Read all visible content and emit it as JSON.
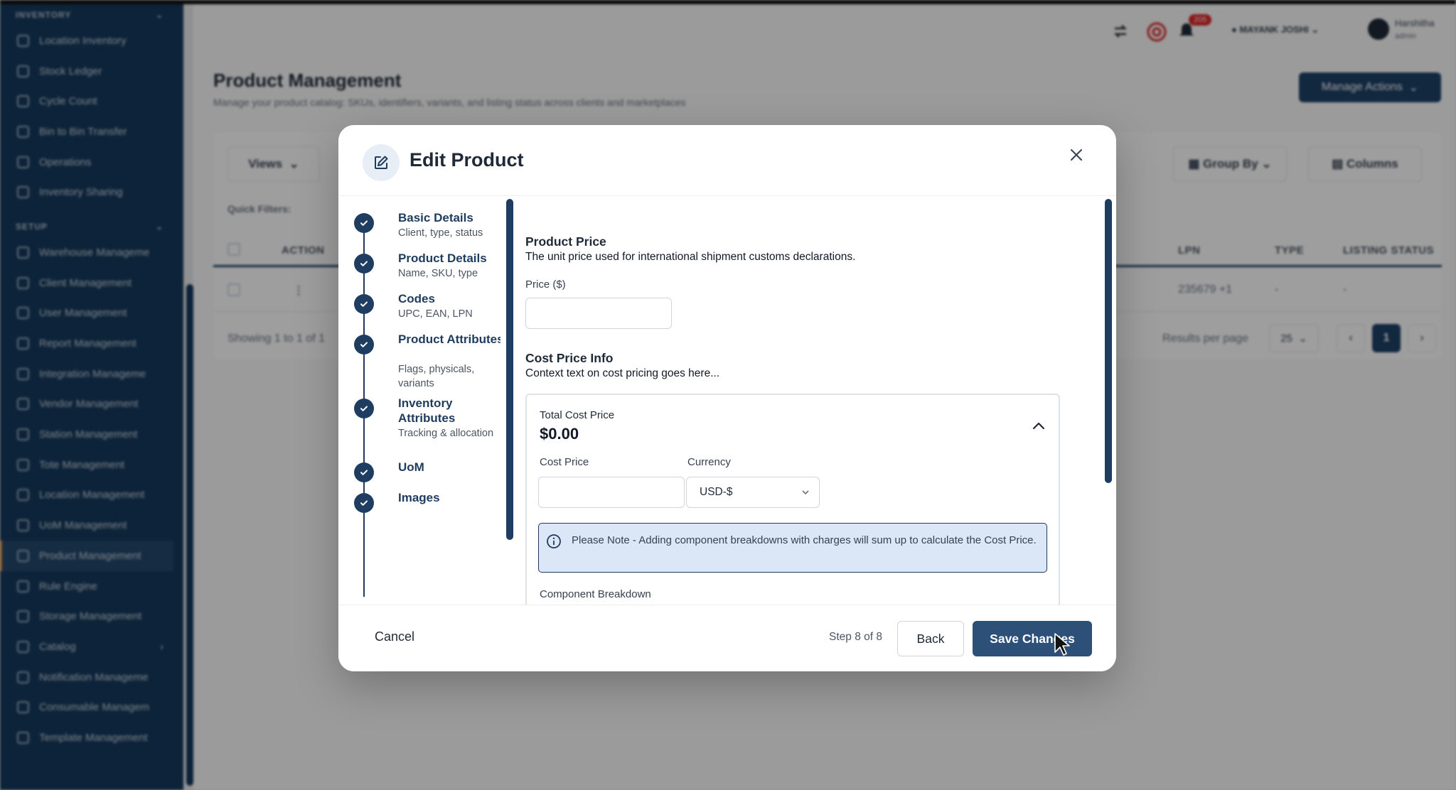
{
  "sidebar": {
    "sections": {
      "inventory": "INVENTORY",
      "setup": "SETUP"
    },
    "inventory_items": [
      {
        "label": "Location Inventory"
      },
      {
        "label": "Stock Ledger"
      },
      {
        "label": "Cycle Count"
      },
      {
        "label": "Bin to Bin Transfer"
      },
      {
        "label": "Operations"
      },
      {
        "label": "Inventory Sharing"
      }
    ],
    "setup_items": [
      {
        "label": "Warehouse Manageme"
      },
      {
        "label": "Client Management"
      },
      {
        "label": "User Management"
      },
      {
        "label": "Report Management"
      },
      {
        "label": "Integration Manageme"
      },
      {
        "label": "Vendor Management"
      },
      {
        "label": "Station Management"
      },
      {
        "label": "Tote Management"
      },
      {
        "label": "Location Management"
      },
      {
        "label": "UoM Management"
      },
      {
        "label": "Product Management"
      },
      {
        "label": "Rule Engine"
      },
      {
        "label": "Storage Management"
      },
      {
        "label": "Catalog"
      },
      {
        "label": "Notification Manageme"
      },
      {
        "label": "Consumable Managem"
      },
      {
        "label": "Template Management"
      }
    ],
    "active_item": "Product Management"
  },
  "topbar": {
    "notification_count": "205",
    "warehouse": "MAYANK JOSHI",
    "user_name": "Harshitha",
    "user_role": "admin"
  },
  "page": {
    "title": "Product Management",
    "subtitle": "Manage your product catalog: SKUs, identifiers, variants, and listing status across clients and marketplaces",
    "manage_actions": "Manage Actions",
    "views": "Views",
    "group_by": "Group By",
    "columns": "Columns",
    "quick_filters": "Quick Filters:",
    "table_headers": {
      "action": "ACTION",
      "lpn": "LPN",
      "type": "TYPE",
      "listing_status": "LISTING STATUS"
    },
    "row": {
      "lpn": "235679 +1",
      "type": "-",
      "listing_status": "-"
    },
    "showing": "Showing 1 to 1 of 1",
    "results_per_page": "Results per page",
    "per_page_value": "25",
    "current_page": "1"
  },
  "modal": {
    "title": "Edit Product",
    "steps": [
      {
        "title": "Basic Details",
        "subtitle": "Client, type, status"
      },
      {
        "title": "Product Details",
        "subtitle": "Name, SKU, type"
      },
      {
        "title": "Codes",
        "subtitle": "UPC, EAN, LPN"
      },
      {
        "title": "Product Attributes",
        "subtitle": "Flags, physicals, variants"
      },
      {
        "title": "Inventory Attributes",
        "subtitle": "Tracking & allocation"
      },
      {
        "title": "UoM",
        "subtitle": ""
      },
      {
        "title": "Images",
        "subtitle": ""
      }
    ],
    "product_price": {
      "title": "Product Price",
      "description": "The unit price used for international shipment customs declarations.",
      "price_label": "Price ($)",
      "price_value": ""
    },
    "cost_price_info": {
      "title": "Cost Price Info",
      "description": "Context text on cost pricing goes here...",
      "total_label": "Total Cost Price",
      "total_value": "$0.00",
      "cost_price_label": "Cost Price",
      "cost_price_value": "",
      "currency_label": "Currency",
      "currency_value": "USD-$",
      "note": "Please Note - Adding component breakdowns with charges will sum up to calculate the Cost Price.",
      "component_breakdown_label": "Component Breakdown"
    },
    "footer": {
      "cancel": "Cancel",
      "step_indicator": "Step 8 of 8",
      "back": "Back",
      "save": "Save Changes"
    }
  },
  "colors": {
    "sidebar_bg": "#15395c",
    "primary": "#2c5078",
    "step_dot": "#1e3d60",
    "note_bg": "#dbe6f6"
  }
}
